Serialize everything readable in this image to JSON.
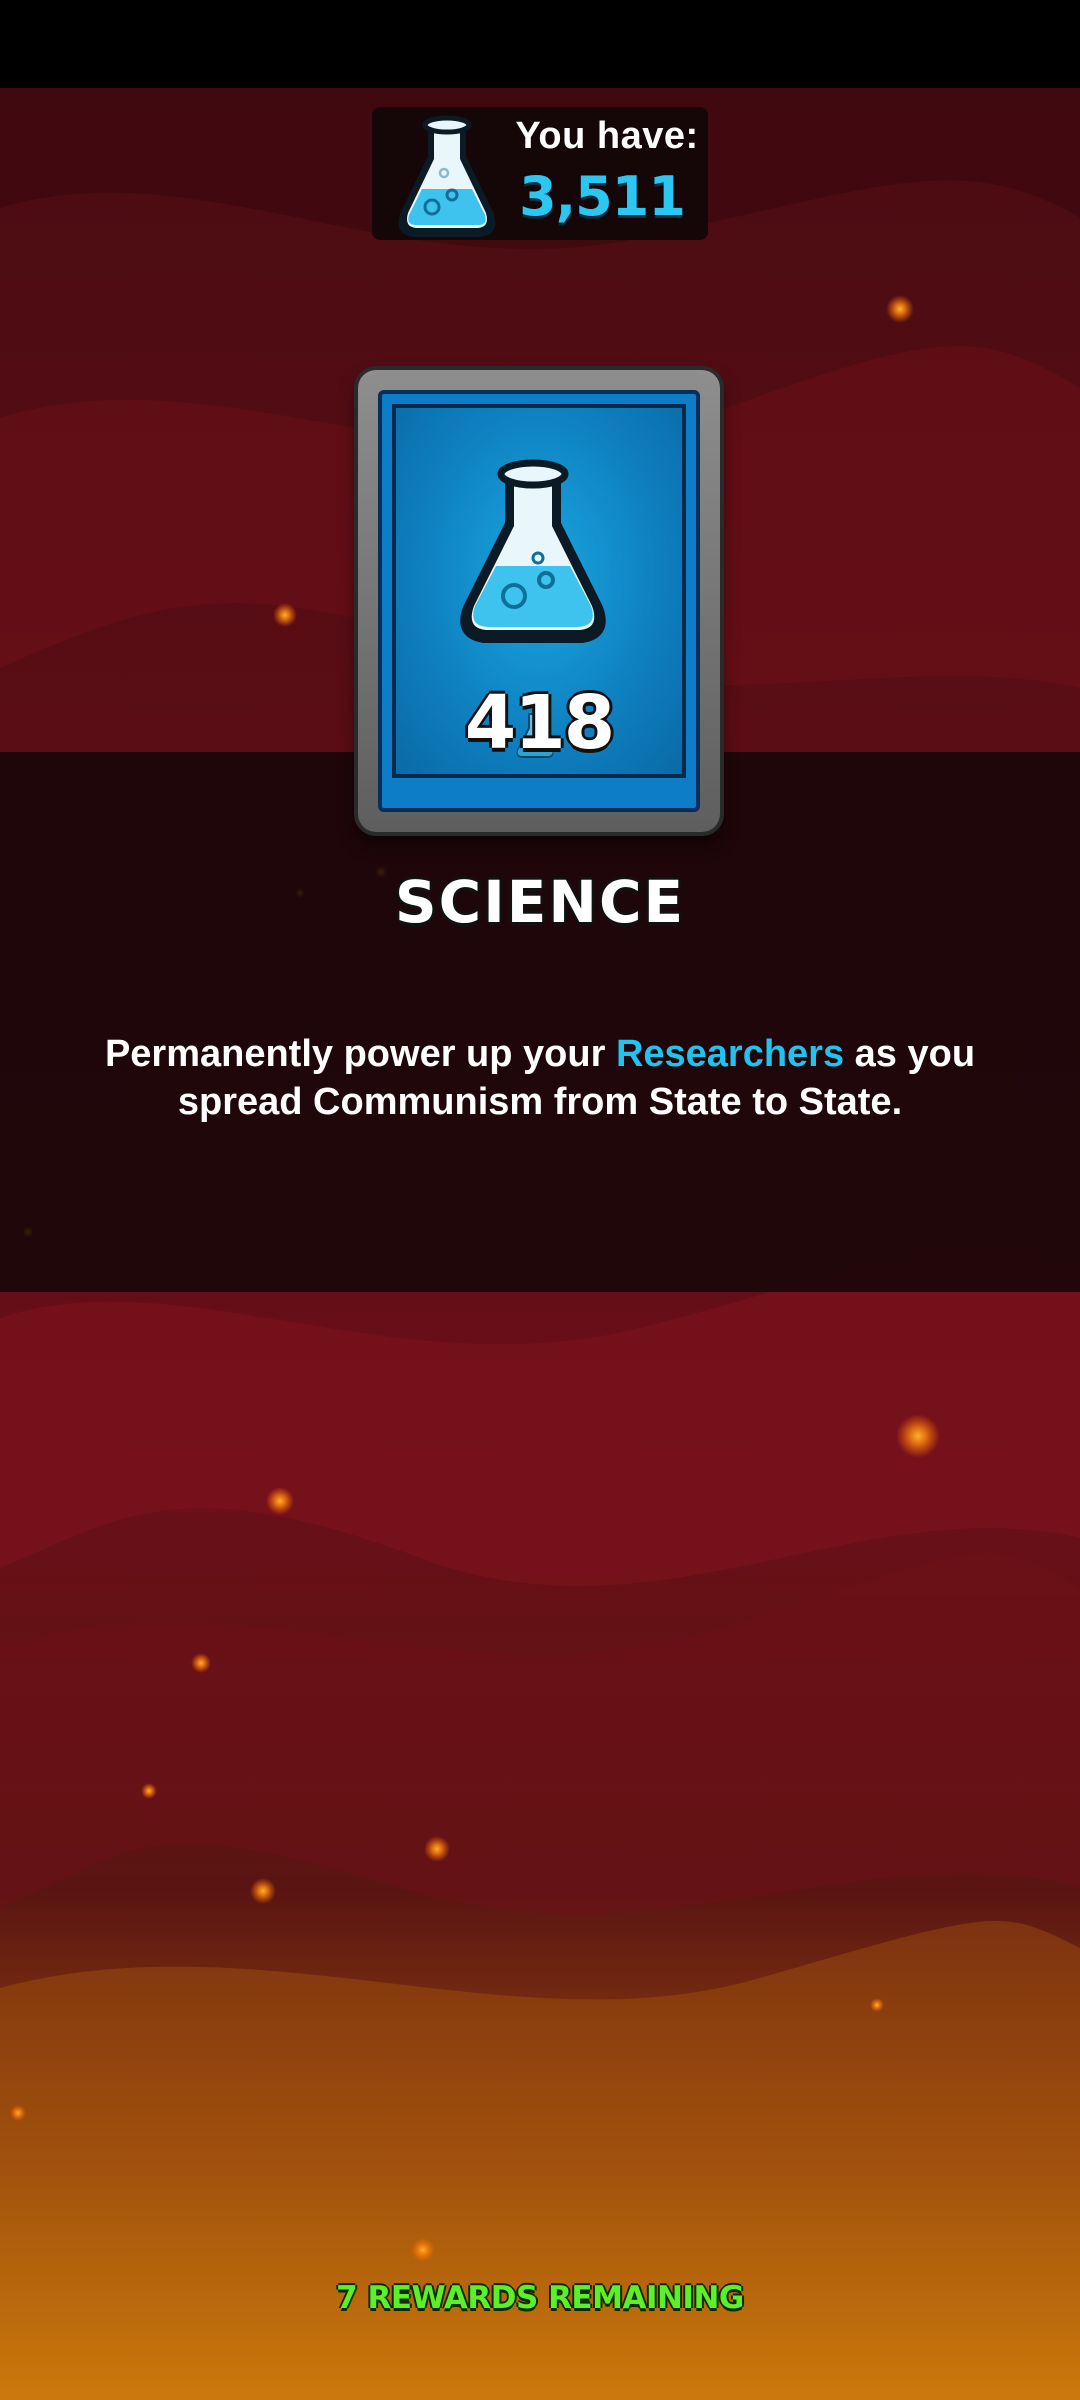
{
  "currency": {
    "label": "You have:",
    "amount": "3,511",
    "icon": "science-flask-icon"
  },
  "card": {
    "count": "418",
    "icon": "science-flask-icon"
  },
  "reward": {
    "name": "SCIENCE"
  },
  "description": {
    "before": "Permanently power up your ",
    "highlight": "Researchers",
    "after": " as you spread Communism from State to State."
  },
  "footer": {
    "remaining": "7 REWARDS REMAINING"
  },
  "colors": {
    "science_blue": "#22c2ee",
    "remaining_green": "#5cf02a",
    "background_red": "#7a0f1a",
    "background_orange": "#d9820a"
  }
}
